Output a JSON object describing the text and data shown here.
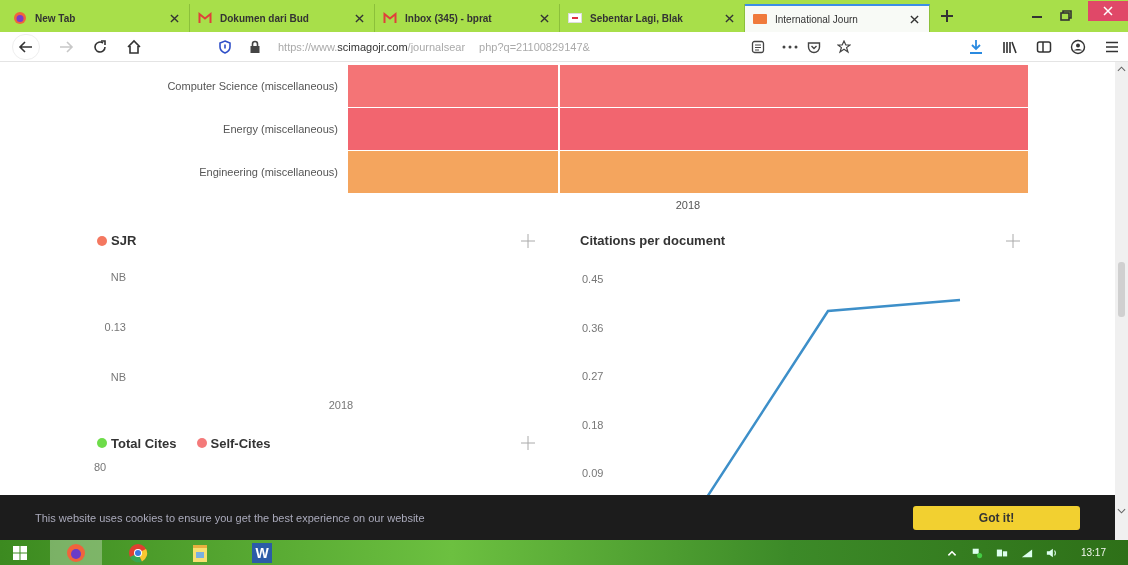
{
  "browser": {
    "tabs": [
      {
        "title": "New Tab",
        "kind": "firefox",
        "selected": false
      },
      {
        "title": "Dokumen dari Bud",
        "kind": "gmail",
        "selected": false
      },
      {
        "title": "Inbox (345) - bprat",
        "kind": "gmail",
        "selected": false
      },
      {
        "title": "Sebentar Lagi, Blak",
        "kind": "flag",
        "selected": false
      },
      {
        "title": "International Journ",
        "kind": "sjr",
        "selected": true
      }
    ],
    "address": {
      "prefix": "https://www.",
      "domain": "scimagojr.com",
      "path": "/journalsear",
      "tail": "php?q=21100829147&"
    },
    "forward_disabled": true
  },
  "heatmap": {
    "rows": [
      {
        "label": "Computer Science (miscellaneous)",
        "cells": [
          {
            "color": "#f47476"
          },
          {
            "color": "#f47476"
          }
        ]
      },
      {
        "label": "Energy (miscellaneous)",
        "cells": [
          {
            "color": "#f2656f"
          },
          {
            "color": "#f2656f"
          }
        ]
      },
      {
        "label": "Engineering (miscellaneous)",
        "cells": [
          {
            "color": "#f4a55e"
          },
          {
            "color": "#f4a55e"
          }
        ]
      }
    ],
    "x_label": "2018"
  },
  "sjr_panel": {
    "legend": [
      {
        "label": "SJR",
        "color": "#f47860"
      }
    ],
    "y_labels": [
      "NB",
      "0.13",
      "NB"
    ],
    "x_label": "2018"
  },
  "citations_panel": {
    "title": "Citations per document",
    "y_labels": [
      "0.45",
      "0.36",
      "0.27",
      "0.18",
      "0.09"
    ]
  },
  "cites_panel": {
    "legend": [
      {
        "label": "Total Cites",
        "color": "#6edc4a"
      },
      {
        "label": "Self-Cites",
        "color": "#f47a7a"
      }
    ],
    "y_labels": [
      "80"
    ]
  },
  "cookie_banner": {
    "message": "This website uses cookies to ensure you get the best experience on our website",
    "button": "Got it!"
  },
  "taskbar": {
    "apps": [
      {
        "kind": "firefox",
        "selected": true
      },
      {
        "kind": "chrome",
        "selected": false
      },
      {
        "kind": "notes",
        "selected": false
      },
      {
        "kind": "word",
        "label": "W",
        "selected": false
      }
    ],
    "time": "13:17"
  }
}
